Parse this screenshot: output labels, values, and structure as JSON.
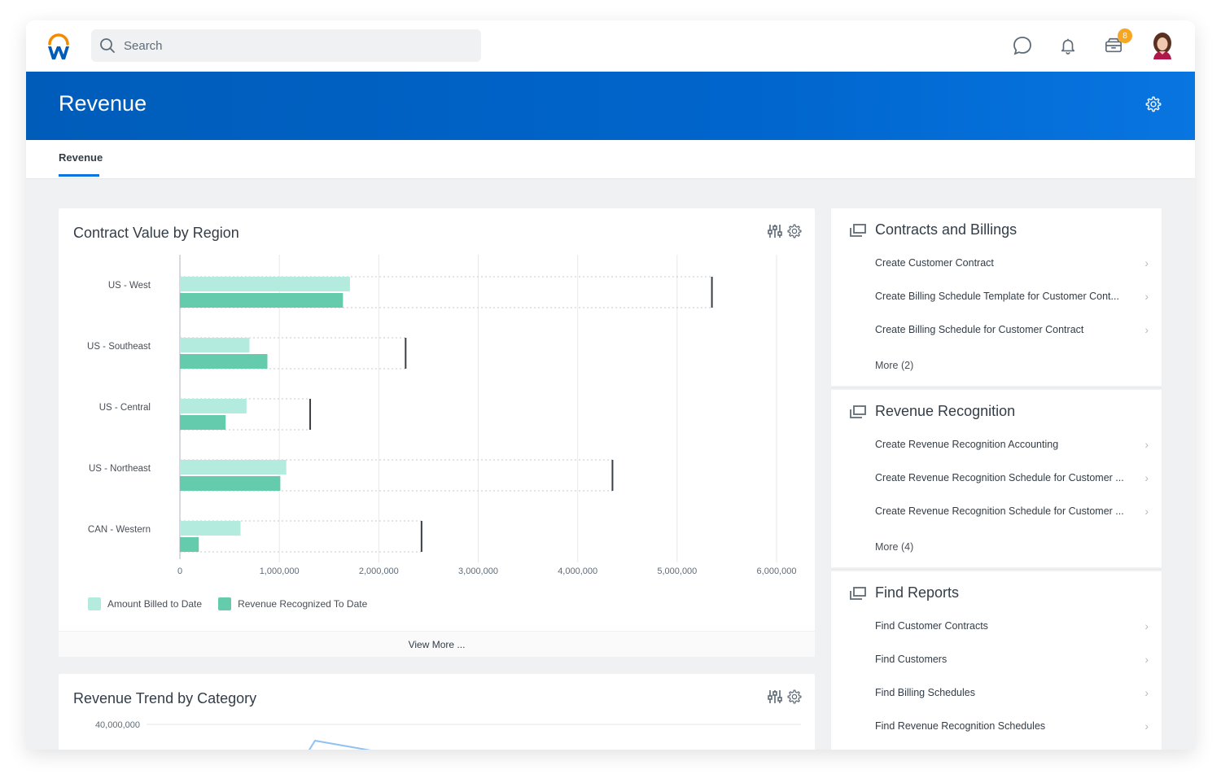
{
  "app": {
    "brand": "Workday",
    "search": {
      "placeholder": "Search",
      "value": ""
    },
    "topbar_icons": [
      {
        "name": "chat-icon"
      },
      {
        "name": "notifications-bell-icon"
      },
      {
        "name": "inbox-icon",
        "badge": "8"
      },
      {
        "name": "user-avatar"
      }
    ],
    "badge_color": "#f5a623",
    "accent_color": "#0875e1"
  },
  "page": {
    "title": "Revenue",
    "tabs": [
      {
        "label": "Revenue",
        "active": true
      }
    ]
  },
  "contract_card": {
    "title": "Contract Value by Region",
    "view_more": "View More ...",
    "legend": [
      {
        "label": "Amount Billed to Date",
        "color": "#b3ecdf"
      },
      {
        "label": "Revenue Recognized To Date",
        "color": "#64cbad"
      }
    ]
  },
  "trend_card": {
    "title": "Revenue Trend by Category",
    "y_tick_top": "40,000,000"
  },
  "chart_data": [
    {
      "type": "bar",
      "orientation": "horizontal",
      "title": "Contract Value by Region",
      "categories": [
        "US - West",
        "US - Southeast",
        "US - Central",
        "US - Northeast",
        "CAN - Western"
      ],
      "series": [
        {
          "name": "Amount Billed to Date",
          "color": "#b3ecdf",
          "values": [
            1710000,
            700000,
            670000,
            1070000,
            610000
          ]
        },
        {
          "name": "Revenue Recognized To Date",
          "color": "#64cbad",
          "values": [
            1640000,
            880000,
            460000,
            1010000,
            190000
          ]
        }
      ],
      "targets": {
        "name": "Total Contract Value",
        "values": [
          5350000,
          2270000,
          1310000,
          4350000,
          2430000
        ]
      },
      "xlim": [
        0,
        6000000
      ],
      "xticks": [
        "0",
        "1,000,000",
        "2,000,000",
        "3,000,000",
        "4,000,000",
        "5,000,000",
        "6,000,000"
      ],
      "xtick_values": [
        0,
        1000000,
        2000000,
        3000000,
        4000000,
        5000000,
        6000000
      ],
      "grid": true,
      "legend_position": "bottom-left"
    },
    {
      "type": "line",
      "title": "Revenue Trend by Category",
      "yticks": [
        "40,000,000"
      ],
      "note": "partially visible"
    }
  ],
  "sections": [
    {
      "title": "Contracts and Billings",
      "items": [
        "Create Customer Contract",
        "Create Billing Schedule Template for Customer Cont...",
        "Create Billing Schedule for Customer Contract"
      ],
      "more": "More (2)"
    },
    {
      "title": "Revenue Recognition",
      "items": [
        "Create Revenue Recognition Accounting",
        "Create Revenue Recognition Schedule for Customer ...",
        "Create Revenue Recognition Schedule for Customer ..."
      ],
      "more": "More (4)"
    },
    {
      "title": "Find Reports",
      "items": [
        "Find Customer Contracts",
        "Find Customers",
        "Find Billing Schedules",
        "Find Revenue Recognition Schedules"
      ]
    }
  ]
}
